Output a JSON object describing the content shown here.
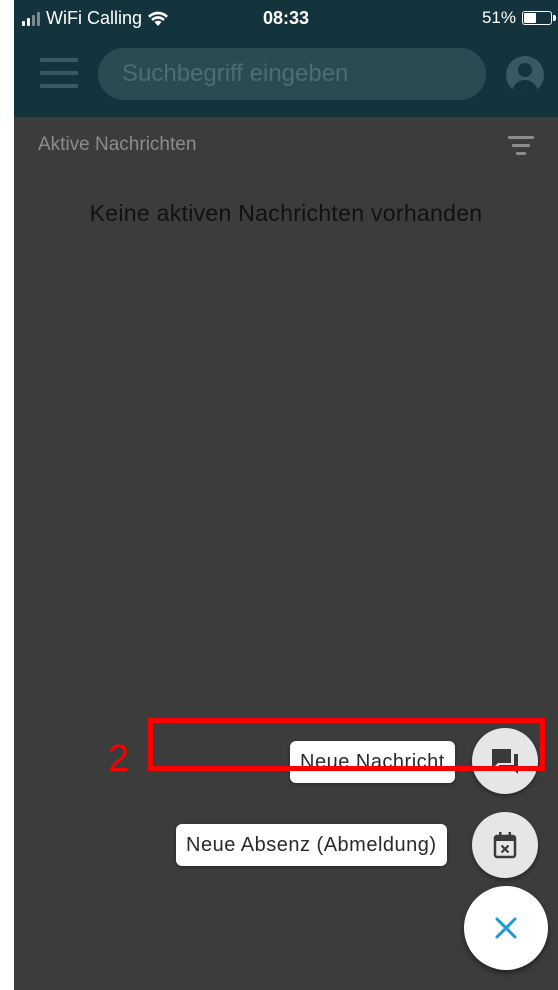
{
  "status_bar": {
    "carrier": "WiFi Calling",
    "time": "08:33",
    "battery": "51%",
    "battery_level": 0.51
  },
  "header": {
    "menu_icon": "hamburger-menu-icon",
    "search_placeholder": "Suchbegriff eingeben",
    "search_value": "",
    "profile_icon": "account-circle-icon",
    "background_color": "#14343d"
  },
  "content": {
    "section_title": "Aktive Nachrichten",
    "filter_icon": "filter-sort-icon",
    "empty_message": "Keine aktiven Nachrichten vorhanden"
  },
  "speed_dial": {
    "actions": [
      {
        "label": "Neue Nachricht",
        "icon": "chat-message-icon"
      },
      {
        "label": "Neue Absenz (Abmeldung)",
        "icon": "calendar-cancel-icon"
      }
    ],
    "close_icon": "close-icon",
    "accent_color": "#1a9ad6"
  },
  "annotation": {
    "number": "2",
    "color": "#ff0000"
  }
}
